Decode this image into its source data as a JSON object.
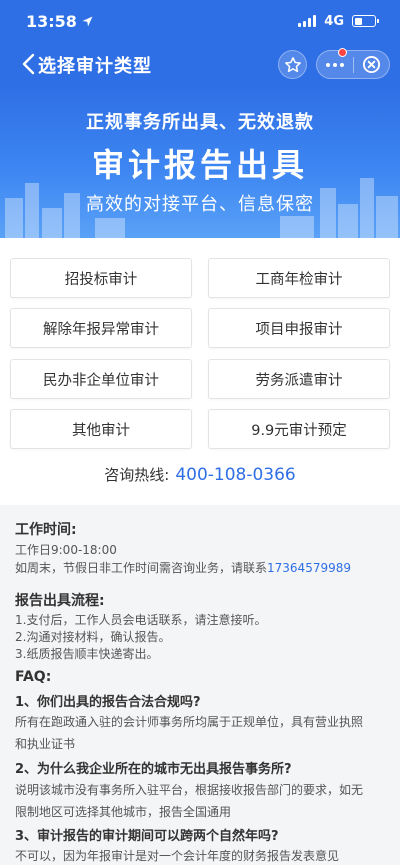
{
  "status_bar": {
    "time": "13:58",
    "network": "4G"
  },
  "nav": {
    "title": "选择审计类型"
  },
  "banner": {
    "line1": "正规事务所出具、无效退款",
    "line2": "审计报告出具",
    "line3": "高效的对接平台、信息保密"
  },
  "buttons": [
    {
      "label": "招投标审计"
    },
    {
      "label": "工商年检审计"
    },
    {
      "label": "解除年报异常审计"
    },
    {
      "label": "项目申报审计"
    },
    {
      "label": "民办非企单位审计"
    },
    {
      "label": "劳务派遣审计"
    },
    {
      "label": "其他审计"
    },
    {
      "label": "9.9元审计预定"
    }
  ],
  "hotline": {
    "label": "咨询热线:",
    "number": "400-108-0366"
  },
  "work_time": {
    "title": "工作时间:",
    "weekday": "工作日9:00-18:00",
    "weekend_prefix": "如周末，节假日非工作时间需咨询业务，请联系",
    "weekend_phone": "17364579989"
  },
  "process": {
    "title": "报告出具流程:",
    "steps": [
      "1.支付后，工作人员会电话联系，请注意接听。",
      "2.沟通对接材料，确认报告。",
      "3.纸质报告顺丰快递寄出。"
    ]
  },
  "faq": {
    "title": "FAQ:",
    "items": [
      {
        "q": "1、你们出具的报告合法合规吗?",
        "a1": "所有在跑政通入驻的会计师事务所均属于正规单位，具有营业执照",
        "a2": "和执业证书"
      },
      {
        "q": "2、为什么我企业所在的城市无出具报告事务所?",
        "a1": "说明该城市没有事务所入驻平台，根据接收报告部门的要求，如无",
        "a2": "限制地区可选择其他城市，报告全国通用"
      },
      {
        "q": "3、审计报告的审计期间可以跨两个自然年吗?",
        "a1": "不可以，因为年报审计是对一个会计年度的财务报告发表意见"
      }
    ]
  }
}
